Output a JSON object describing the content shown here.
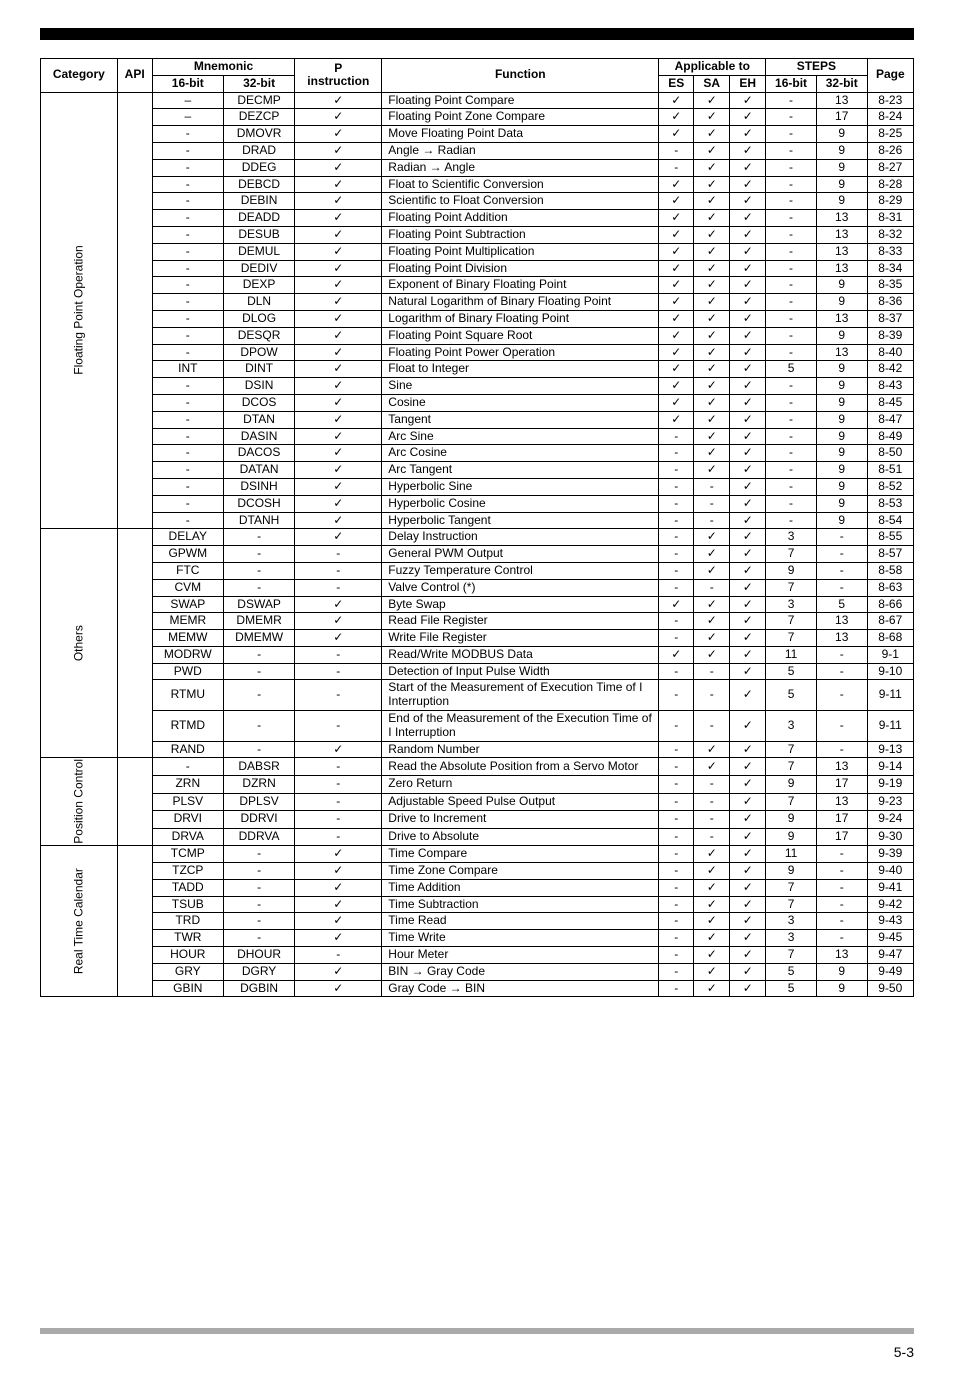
{
  "footer": {
    "page": "5-3"
  },
  "headers": {
    "category": "Category",
    "api": "API",
    "mnemonic": "Mnemonic",
    "p": "P",
    "instruction": "instruction",
    "function": "Function",
    "applicable": "Applicable to",
    "steps": "STEPS",
    "page": "Page",
    "b16": "16-bit",
    "b32": "32-bit",
    "es": "ES",
    "sa": "SA",
    "eh": "EH",
    "s16": "16-bit",
    "s32": "32-bit"
  },
  "categories": [
    {
      "name": "Floating Point Operation",
      "span": 25,
      "rows": [
        {
          "b16": "–",
          "b32": "DECMP",
          "p": "✓",
          "func": "Floating Point Compare",
          "es": "✓",
          "sa": "✓",
          "eh": "✓",
          "s16": "-",
          "s32": "13",
          "page": "8-23"
        },
        {
          "b16": "–",
          "b32": "DEZCP",
          "p": "✓",
          "func": "Floating Point Zone Compare",
          "es": "✓",
          "sa": "✓",
          "eh": "✓",
          "s16": "-",
          "s32": "17",
          "page": "8-24"
        },
        {
          "b16": "-",
          "b32": "DMOVR",
          "p": "✓",
          "func": "Move Floating Point Data",
          "es": "✓",
          "sa": "✓",
          "eh": "✓",
          "s16": "-",
          "s32": "9",
          "page": "8-25"
        },
        {
          "b16": "-",
          "b32": "DRAD",
          "p": "✓",
          "func": "Angle → Radian",
          "es": "-",
          "sa": "✓",
          "eh": "✓",
          "s16": "-",
          "s32": "9",
          "page": "8-26"
        },
        {
          "b16": "-",
          "b32": "DDEG",
          "p": "✓",
          "func": "Radian → Angle",
          "es": "-",
          "sa": "✓",
          "eh": "✓",
          "s16": "-",
          "s32": "9",
          "page": "8-27"
        },
        {
          "b16": "-",
          "b32": "DEBCD",
          "p": "✓",
          "func": "Float to Scientific Conversion",
          "es": "✓",
          "sa": "✓",
          "eh": "✓",
          "s16": "-",
          "s32": "9",
          "page": "8-28"
        },
        {
          "b16": "-",
          "b32": "DEBIN",
          "p": "✓",
          "func": "Scientific to Float Conversion",
          "es": "✓",
          "sa": "✓",
          "eh": "✓",
          "s16": "-",
          "s32": "9",
          "page": "8-29"
        },
        {
          "b16": "-",
          "b32": "DEADD",
          "p": "✓",
          "func": "Floating Point Addition",
          "es": "✓",
          "sa": "✓",
          "eh": "✓",
          "s16": "-",
          "s32": "13",
          "page": "8-31"
        },
        {
          "b16": "-",
          "b32": "DESUB",
          "p": "✓",
          "func": "Floating Point Subtraction",
          "es": "✓",
          "sa": "✓",
          "eh": "✓",
          "s16": "-",
          "s32": "13",
          "page": "8-32"
        },
        {
          "b16": "-",
          "b32": "DEMUL",
          "p": "✓",
          "func": "Floating Point Multiplication",
          "es": "✓",
          "sa": "✓",
          "eh": "✓",
          "s16": "-",
          "s32": "13",
          "page": "8-33"
        },
        {
          "b16": "-",
          "b32": "DEDIV",
          "p": "✓",
          "func": "Floating Point Division",
          "es": "✓",
          "sa": "✓",
          "eh": "✓",
          "s16": "-",
          "s32": "13",
          "page": "8-34"
        },
        {
          "b16": "-",
          "b32": "DEXP",
          "p": "✓",
          "func": "Exponent of Binary Floating Point",
          "es": "✓",
          "sa": "✓",
          "eh": "✓",
          "s16": "-",
          "s32": "9",
          "page": "8-35"
        },
        {
          "b16": "-",
          "b32": "DLN",
          "p": "✓",
          "func": "Natural Logarithm of Binary Floating Point",
          "es": "✓",
          "sa": "✓",
          "eh": "✓",
          "s16": "-",
          "s32": "9",
          "page": "8-36"
        },
        {
          "b16": "-",
          "b32": "DLOG",
          "p": "✓",
          "func": "Logarithm of Binary Floating Point",
          "es": "✓",
          "sa": "✓",
          "eh": "✓",
          "s16": "-",
          "s32": "13",
          "page": "8-37"
        },
        {
          "b16": "-",
          "b32": "DESQR",
          "p": "✓",
          "func": "Floating Point Square Root",
          "es": "✓",
          "sa": "✓",
          "eh": "✓",
          "s16": "-",
          "s32": "9",
          "page": "8-39"
        },
        {
          "b16": "-",
          "b32": "DPOW",
          "p": "✓",
          "func": "Floating Point Power Operation",
          "es": "✓",
          "sa": "✓",
          "eh": "✓",
          "s16": "-",
          "s32": "13",
          "page": "8-40"
        },
        {
          "b16": "INT",
          "b32": "DINT",
          "p": "✓",
          "func": "Float to Integer",
          "es": "✓",
          "sa": "✓",
          "eh": "✓",
          "s16": "5",
          "s32": "9",
          "page": "8-42"
        },
        {
          "b16": "-",
          "b32": "DSIN",
          "p": "✓",
          "func": "Sine",
          "es": "✓",
          "sa": "✓",
          "eh": "✓",
          "s16": "-",
          "s32": "9",
          "page": "8-43"
        },
        {
          "b16": "-",
          "b32": "DCOS",
          "p": "✓",
          "func": "Cosine",
          "es": "✓",
          "sa": "✓",
          "eh": "✓",
          "s16": "-",
          "s32": "9",
          "page": "8-45"
        },
        {
          "b16": "-",
          "b32": "DTAN",
          "p": "✓",
          "func": "Tangent",
          "es": "✓",
          "sa": "✓",
          "eh": "✓",
          "s16": "-",
          "s32": "9",
          "page": "8-47"
        },
        {
          "b16": "-",
          "b32": "DASIN",
          "p": "✓",
          "func": "Arc Sine",
          "es": "-",
          "sa": "✓",
          "eh": "✓",
          "s16": "-",
          "s32": "9",
          "page": "8-49"
        },
        {
          "b16": "-",
          "b32": "DACOS",
          "p": "✓",
          "func": "Arc Cosine",
          "es": "-",
          "sa": "✓",
          "eh": "✓",
          "s16": "-",
          "s32": "9",
          "page": "8-50"
        },
        {
          "b16": "-",
          "b32": "DATAN",
          "p": "✓",
          "func": "Arc Tangent",
          "es": "-",
          "sa": "✓",
          "eh": "✓",
          "s16": "-",
          "s32": "9",
          "page": "8-51"
        },
        {
          "b16": "-",
          "b32": "DSINH",
          "p": "✓",
          "func": "Hyperbolic Sine",
          "es": "-",
          "sa": "-",
          "eh": "✓",
          "s16": "-",
          "s32": "9",
          "page": "8-52"
        },
        {
          "b16": "-",
          "b32": "DCOSH",
          "p": "✓",
          "func": "Hyperbolic Cosine",
          "es": "-",
          "sa": "-",
          "eh": "✓",
          "s16": "-",
          "s32": "9",
          "page": "8-53"
        },
        {
          "b16": "-",
          "b32": "DTANH",
          "p": "✓",
          "func": "Hyperbolic Tangent",
          "es": "-",
          "sa": "-",
          "eh": "✓",
          "s16": "-",
          "s32": "9",
          "page": "8-54"
        }
      ]
    },
    {
      "name": "Others",
      "span": 11,
      "rows": [
        {
          "b16": "DELAY",
          "b32": "-",
          "p": "✓",
          "func": "Delay Instruction",
          "es": "-",
          "sa": "✓",
          "eh": "✓",
          "s16": "3",
          "s32": "-",
          "page": "8-55"
        },
        {
          "b16": "GPWM",
          "b32": "-",
          "p": "-",
          "func": "General PWM Output",
          "es": "-",
          "sa": "✓",
          "eh": "✓",
          "s16": "7",
          "s32": "-",
          "page": "8-57"
        },
        {
          "b16": "FTC",
          "b32": "-",
          "p": "-",
          "func": "Fuzzy Temperature Control",
          "es": "-",
          "sa": "✓",
          "eh": "✓",
          "s16": "9",
          "s32": "-",
          "page": "8-58"
        },
        {
          "b16": "CVM",
          "b32": "-",
          "p": "-",
          "func": "Valve Control (*)",
          "es": "-",
          "sa": "-",
          "eh": "✓",
          "s16": "7",
          "s32": "-",
          "page": "8-63"
        },
        {
          "b16": "SWAP",
          "b32": "DSWAP",
          "p": "✓",
          "func": "Byte Swap",
          "es": "✓",
          "sa": "✓",
          "eh": "✓",
          "s16": "3",
          "s32": "5",
          "page": "8-66"
        },
        {
          "b16": "MEMR",
          "b32": "DMEMR",
          "p": "✓",
          "func": "Read File Register",
          "es": "-",
          "sa": "✓",
          "eh": "✓",
          "s16": "7",
          "s32": "13",
          "page": "8-67"
        },
        {
          "b16": "MEMW",
          "b32": "DMEMW",
          "p": "✓",
          "func": "Write File Register",
          "es": "-",
          "sa": "✓",
          "eh": "✓",
          "s16": "7",
          "s32": "13",
          "page": "8-68"
        },
        {
          "b16": "MODRW",
          "b32": "-",
          "p": "-",
          "func": "Read/Write MODBUS Data",
          "es": "✓",
          "sa": "✓",
          "eh": "✓",
          "s16": "11",
          "s32": "-",
          "page": "9-1"
        },
        {
          "b16": "PWD",
          "b32": "-",
          "p": "-",
          "func": "Detection of Input Pulse Width",
          "es": "-",
          "sa": "-",
          "eh": "✓",
          "s16": "5",
          "s32": "-",
          "page": "9-10"
        },
        {
          "b16": "RTMU",
          "b32": "-",
          "p": "-",
          "func": "Start of the Measurement of Execution Time of I Interruption",
          "es": "-",
          "sa": "-",
          "eh": "✓",
          "s16": "5",
          "s32": "-",
          "page": "9-11"
        },
        {
          "b16": "RTMD",
          "b32": "-",
          "p": "-",
          "func": "End of the Measurement of the Execution Time of I Interruption",
          "es": "-",
          "sa": "-",
          "eh": "✓",
          "s16": "3",
          "s32": "-",
          "page": "9-11"
        },
        {
          "b16": "RAND",
          "b32": "-",
          "p": "✓",
          "func": "Random Number",
          "es": "-",
          "sa": "✓",
          "eh": "✓",
          "s16": "7",
          "s32": "-",
          "page": "9-13"
        }
      ]
    },
    {
      "name": "Position Control",
      "span": 5,
      "rows": [
        {
          "b16": "-",
          "b32": "DABSR",
          "p": "-",
          "func": "Read the Absolute Position from a Servo Motor",
          "es": "-",
          "sa": "✓",
          "eh": "✓",
          "s16": "7",
          "s32": "13",
          "page": "9-14"
        },
        {
          "b16": "ZRN",
          "b32": "DZRN",
          "p": "-",
          "func": "Zero Return",
          "es": "-",
          "sa": "-",
          "eh": "✓",
          "s16": "9",
          "s32": "17",
          "page": "9-19"
        },
        {
          "b16": "PLSV",
          "b32": "DPLSV",
          "p": "-",
          "func": "Adjustable Speed Pulse Output",
          "es": "-",
          "sa": "-",
          "eh": "✓",
          "s16": "7",
          "s32": "13",
          "page": "9-23"
        },
        {
          "b16": "DRVI",
          "b32": "DDRVI",
          "p": "-",
          "func": "Drive to Increment",
          "es": "-",
          "sa": "-",
          "eh": "✓",
          "s16": "9",
          "s32": "17",
          "page": "9-24"
        },
        {
          "b16": "DRVA",
          "b32": "DDRVA",
          "p": "-",
          "func": "Drive to Absolute",
          "es": "-",
          "sa": "-",
          "eh": "✓",
          "s16": "9",
          "s32": "17",
          "page": "9-30"
        }
      ]
    },
    {
      "name": "Real Time Calendar",
      "span": 9,
      "rows": [
        {
          "b16": "TCMP",
          "b32": "-",
          "p": "✓",
          "func": "Time Compare",
          "es": "-",
          "sa": "✓",
          "eh": "✓",
          "s16": "11",
          "s32": "-",
          "page": "9-39"
        },
        {
          "b16": "TZCP",
          "b32": "-",
          "p": "✓",
          "func": "Time Zone Compare",
          "es": "-",
          "sa": "✓",
          "eh": "✓",
          "s16": "9",
          "s32": "-",
          "page": "9-40"
        },
        {
          "b16": "TADD",
          "b32": "-",
          "p": "✓",
          "func": "Time Addition",
          "es": "-",
          "sa": "✓",
          "eh": "✓",
          "s16": "7",
          "s32": "-",
          "page": "9-41"
        },
        {
          "b16": "TSUB",
          "b32": "-",
          "p": "✓",
          "func": "Time Subtraction",
          "es": "-",
          "sa": "✓",
          "eh": "✓",
          "s16": "7",
          "s32": "-",
          "page": "9-42"
        },
        {
          "b16": "TRD",
          "b32": "-",
          "p": "✓",
          "func": "Time Read",
          "es": "-",
          "sa": "✓",
          "eh": "✓",
          "s16": "3",
          "s32": "-",
          "page": "9-43"
        },
        {
          "b16": "TWR",
          "b32": "-",
          "p": "✓",
          "func": "Time Write",
          "es": "-",
          "sa": "✓",
          "eh": "✓",
          "s16": "3",
          "s32": "-",
          "page": "9-45"
        },
        {
          "b16": "HOUR",
          "b32": "DHOUR",
          "p": "-",
          "func": "Hour Meter",
          "es": "-",
          "sa": "✓",
          "eh": "✓",
          "s16": "7",
          "s32": "13",
          "page": "9-47"
        },
        {
          "b16": "GRY",
          "b32": "DGRY",
          "p": "✓",
          "func": "BIN → Gray Code",
          "es": "-",
          "sa": "✓",
          "eh": "✓",
          "s16": "5",
          "s32": "9",
          "page": "9-49"
        },
        {
          "b16": "GBIN",
          "b32": "DGBIN",
          "p": "✓",
          "func": "Gray Code → BIN",
          "es": "-",
          "sa": "✓",
          "eh": "✓",
          "s16": "5",
          "s32": "9",
          "page": "9-50"
        }
      ]
    }
  ]
}
